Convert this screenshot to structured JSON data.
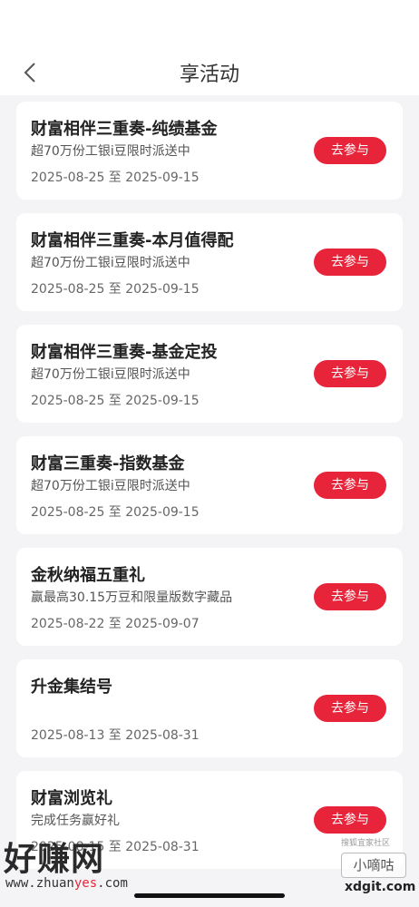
{
  "header": {
    "title": "享活动",
    "back_icon": "chevron-left-icon"
  },
  "activities": [
    {
      "name": "财富相伴三重奏-纯绩基金",
      "desc": "超70万份工银i豆限时派送中",
      "date": "2025-08-25 至 2025-09-15",
      "button": "去参与"
    },
    {
      "name": "财富相伴三重奏-本月值得配",
      "desc": "超70万份工银i豆限时派送中",
      "date": "2025-08-25 至 2025-09-15",
      "button": "去参与"
    },
    {
      "name": "财富相伴三重奏-基金定投",
      "desc": "超70万份工银i豆限时派送中",
      "date": "2025-08-25 至 2025-09-15",
      "button": "去参与"
    },
    {
      "name": "财富三重奏-指数基金",
      "desc": "超70万份工银i豆限时派送中",
      "date": "2025-08-25 至 2025-09-15",
      "button": "去参与"
    },
    {
      "name": "金秋纳福五重礼",
      "desc": "赢最高30.15万豆和限量版数字藏品",
      "date": "2025-08-22 至 2025-09-07",
      "button": "去参与"
    },
    {
      "name": "升金集结号",
      "desc": "",
      "date": "2025-08-13 至 2025-08-31",
      "button": "去参与"
    },
    {
      "name": "财富浏览礼",
      "desc": "完成任务赢好礼",
      "date": "2025-08-15 至 2025-08-31",
      "button": "去参与"
    }
  ],
  "watermark": {
    "left_big": "好赚网",
    "left_url_a": "www.zhuan",
    "left_url_b": "yes",
    "left_url_c": ".com",
    "right_top": "搜狐宜家社区",
    "right_box": "小嘀咕",
    "right_bottom": "xdgit.com"
  },
  "colors": {
    "accent": "#e8243a",
    "background": "#f4f4f6"
  }
}
